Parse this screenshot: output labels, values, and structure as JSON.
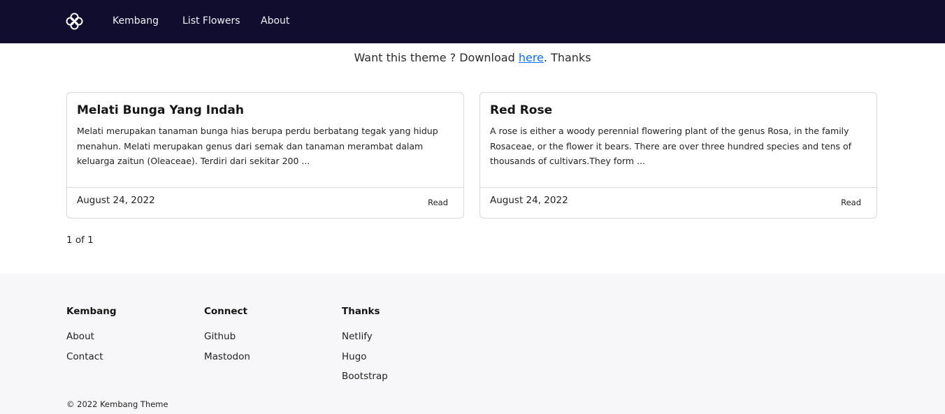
{
  "navbar": {
    "logo_icon": "flower-logo-icon",
    "links": [
      "Kembang",
      "List Flowers",
      "About"
    ]
  },
  "banner": {
    "prefix": "Want this theme ? Download ",
    "link": "here",
    "suffix": ". Thanks"
  },
  "posts": [
    {
      "title": "Melati Bunga Yang Indah",
      "summary": "Melati merupakan tanaman bunga hias berupa perdu berbatang tegak yang hidup menahun. Melati merupakan genus dari semak dan tanaman merambat dalam keluarga zaitun (Oleaceae). Terdiri dari sekitar 200 ...",
      "date": "August 24, 2022",
      "read_label": "Read"
    },
    {
      "title": "Red Rose",
      "summary": "A rose is either a woody perennial flowering plant of the genus Rosa, in the family Rosaceae, or the flower it bears. There are over three hundred species and tens of thousands of cultivars.They form ...",
      "date": "August 24, 2022",
      "read_label": "Read"
    }
  ],
  "pagination": "1 of 1",
  "footer": {
    "columns": [
      {
        "heading": "Kembang",
        "links": [
          "About",
          "Contact"
        ]
      },
      {
        "heading": "Connect",
        "links": [
          "Github",
          "Mastodon"
        ]
      },
      {
        "heading": "Thanks",
        "links": [
          "Netlify",
          "Hugo",
          "Bootstrap"
        ]
      }
    ],
    "copyright": "© 2022 Kembang Theme"
  },
  "colors": {
    "navbar_bg": "#110d2e",
    "link": "#0d6efd",
    "footer_bg": "#f7f7f9"
  }
}
